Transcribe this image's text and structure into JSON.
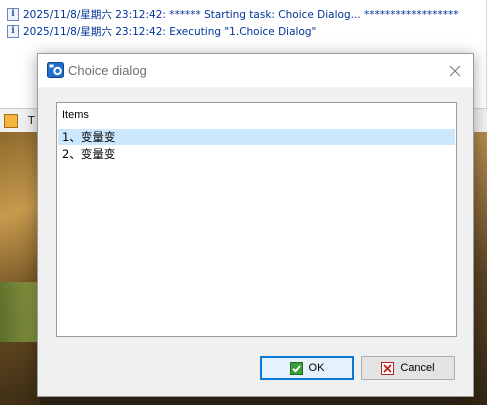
{
  "log": {
    "lines": [
      "2025/11/8/星期六 23:12:42: ****** Starting task: Choice Dialog... ******************",
      "2025/11/8/星期六 23:12:42: Executing \"1.Choice Dialog\""
    ]
  },
  "status": {
    "text": "T"
  },
  "dialog": {
    "title": "Choice dialog",
    "list": {
      "header": "Items",
      "items": [
        "1、变量变",
        "2、变量变"
      ],
      "selected_index": 0
    },
    "buttons": {
      "ok": "OK",
      "cancel": "Cancel"
    }
  },
  "colors": {
    "accent": "#0a78d7",
    "selection": "#cce8ff",
    "log_text": "#003399"
  }
}
